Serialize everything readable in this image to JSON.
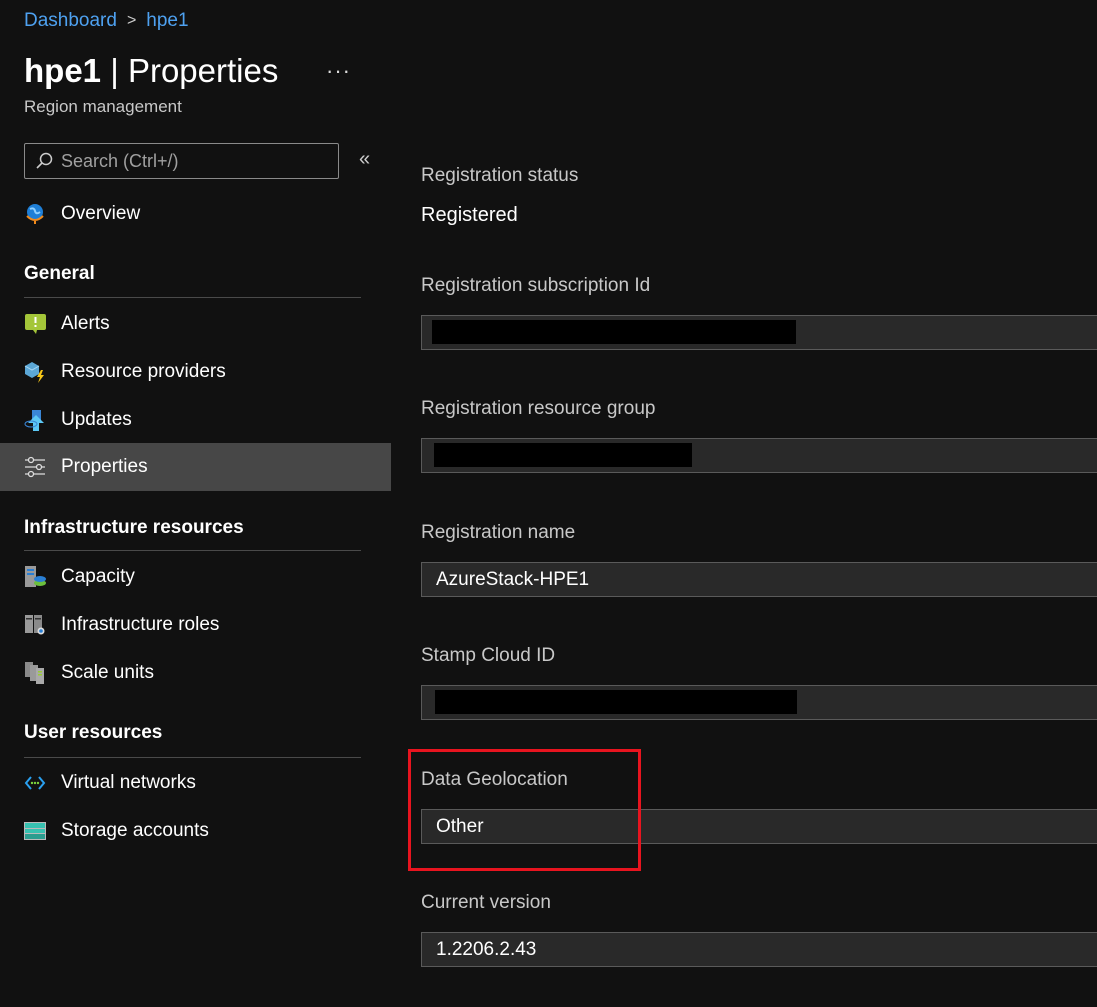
{
  "breadcrumb": {
    "items": [
      "Dashboard",
      "hpe1"
    ],
    "separator": ">"
  },
  "header": {
    "resource": "hpe1",
    "page": "Properties",
    "subtitle": "Region management",
    "more_label": "···"
  },
  "sidebar": {
    "search_placeholder": "Search (Ctrl+/)",
    "collapse_label": "«",
    "overview": {
      "label": "Overview",
      "icon": "globe-icon"
    },
    "sections": [
      {
        "title": "General",
        "items": [
          {
            "label": "Alerts",
            "icon": "alert-icon"
          },
          {
            "label": "Resource providers",
            "icon": "resource-provider-icon"
          },
          {
            "label": "Updates",
            "icon": "update-icon"
          },
          {
            "label": "Properties",
            "icon": "sliders-icon",
            "selected": true
          }
        ]
      },
      {
        "title": "Infrastructure resources",
        "items": [
          {
            "label": "Capacity",
            "icon": "capacity-icon"
          },
          {
            "label": "Infrastructure roles",
            "icon": "infrastructure-roles-icon"
          },
          {
            "label": "Scale units",
            "icon": "scale-units-icon"
          }
        ]
      },
      {
        "title": "User resources",
        "items": [
          {
            "label": "Virtual networks",
            "icon": "virtual-network-icon"
          },
          {
            "label": "Storage accounts",
            "icon": "storage-icon"
          }
        ]
      }
    ]
  },
  "properties": {
    "registration_status": {
      "label": "Registration status",
      "value": "Registered"
    },
    "subscription_id": {
      "label": "Registration subscription Id",
      "value": ""
    },
    "resource_group": {
      "label": "Registration resource group",
      "value": ""
    },
    "registration_name": {
      "label": "Registration name",
      "value": "AzureStack-HPE1"
    },
    "stamp_cloud_id": {
      "label": "Stamp Cloud ID",
      "value": ""
    },
    "data_geolocation": {
      "label": "Data Geolocation",
      "value": "Other"
    },
    "current_version": {
      "label": "Current version",
      "value": "1.2206.2.43"
    }
  },
  "colors": {
    "background": "#111111",
    "link": "#4ea1f0",
    "selected": "#474747",
    "highlight_box": "#e8141f",
    "field": "#292929"
  }
}
